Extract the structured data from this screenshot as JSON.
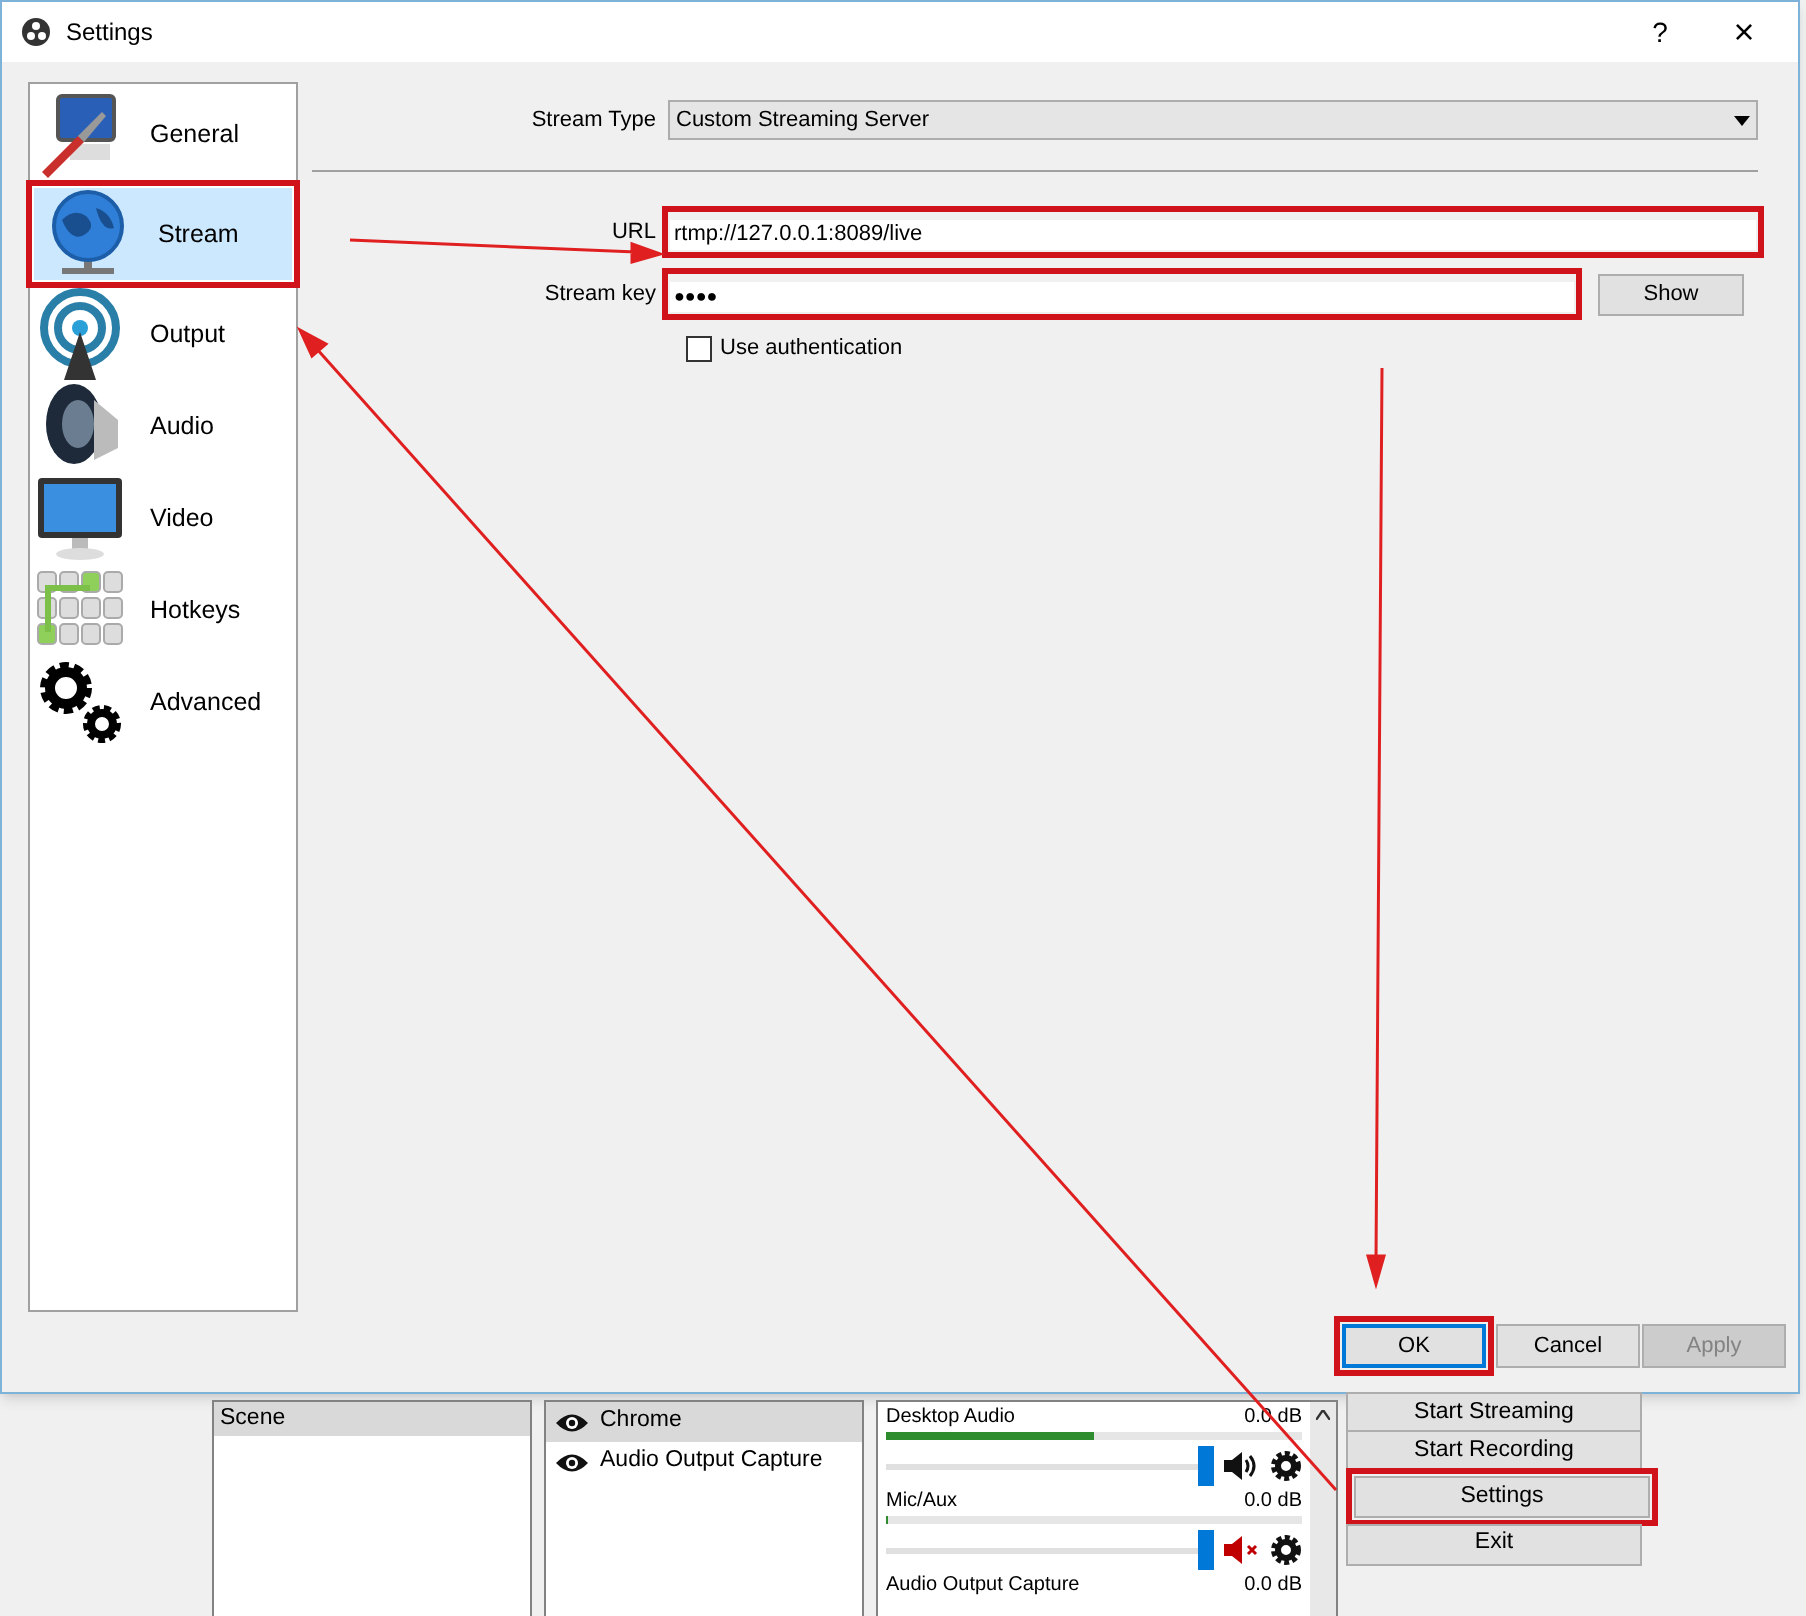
{
  "dialog": {
    "title": "Settings",
    "help": "?",
    "close": "×"
  },
  "sidebar": {
    "items": [
      {
        "label": "General",
        "kind": "general",
        "selected": false,
        "highlighted": false
      },
      {
        "label": "Stream",
        "kind": "stream",
        "selected": true,
        "highlighted": true
      },
      {
        "label": "Output",
        "kind": "output",
        "selected": false,
        "highlighted": false
      },
      {
        "label": "Audio",
        "kind": "audio",
        "selected": false,
        "highlighted": false
      },
      {
        "label": "Video",
        "kind": "video",
        "selected": false,
        "highlighted": false
      },
      {
        "label": "Hotkeys",
        "kind": "hotkeys",
        "selected": false,
        "highlighted": false
      },
      {
        "label": "Advanced",
        "kind": "advanced",
        "selected": false,
        "highlighted": false
      }
    ]
  },
  "stream": {
    "stream_type": {
      "label": "Stream Type",
      "value": "Custom Streaming Server"
    },
    "url": {
      "label": "URL",
      "value": "rtmp://127.0.0.1:8089/live",
      "highlighted": true
    },
    "stream_key": {
      "label": "Stream key",
      "value": "●●●●",
      "highlighted": true
    },
    "show_button": "Show",
    "use_authentication": {
      "label": "Use authentication",
      "checked": false
    }
  },
  "buttons": [
    {
      "label": "OK",
      "focused": true,
      "disabled": false,
      "highlighted": true
    },
    {
      "label": "Cancel",
      "focused": false,
      "disabled": false,
      "highlighted": false
    },
    {
      "label": "Apply",
      "focused": false,
      "disabled": true,
      "highlighted": false
    }
  ],
  "scenes": [
    {
      "label": "Scene",
      "selected": true
    }
  ],
  "sources": [
    {
      "label": "Chrome",
      "selected": true,
      "visible": true
    },
    {
      "label": "Audio Output Capture",
      "selected": false,
      "visible": true
    }
  ],
  "mixer": [
    {
      "name": "Desktop Audio",
      "reading": "0.0 dB",
      "meter": {
        "level": 0.5
      },
      "volume": {
        "level": 1
      },
      "muted": false
    },
    {
      "name": "Mic/Aux",
      "reading": "0.0 dB",
      "meter": {
        "level": 0
      },
      "volume": {
        "level": 1
      },
      "muted": true
    },
    {
      "name": "Audio Output Capture",
      "reading": "0.0 dB"
    }
  ],
  "controls": [
    {
      "label": "Start Streaming",
      "highlighted": false
    },
    {
      "label": "Start Recording",
      "highlighted": false
    },
    {
      "label": "Settings",
      "highlighted": true
    },
    {
      "label": "Exit",
      "highlighted": false
    }
  ]
}
